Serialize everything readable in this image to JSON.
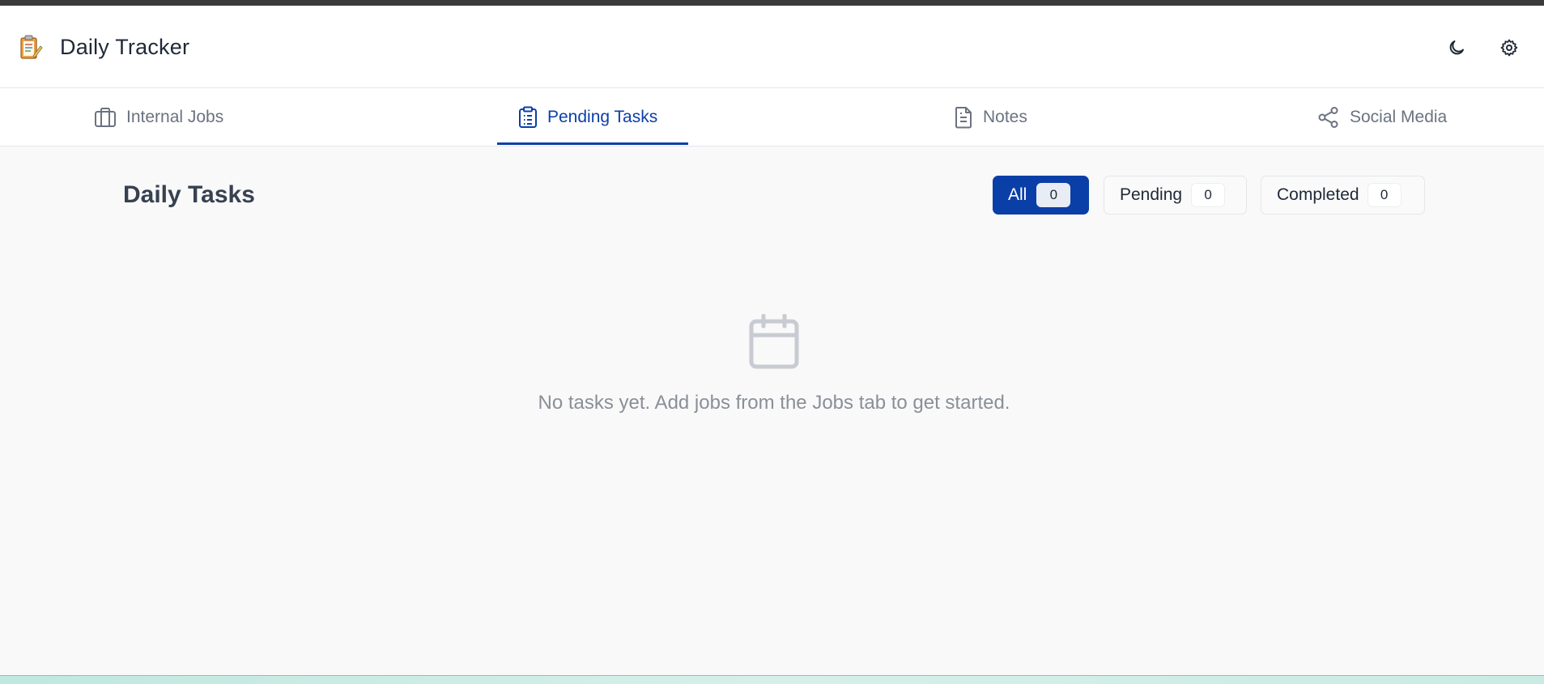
{
  "app": {
    "title": "Daily Tracker",
    "logo_icon": "clipboard-emoji-icon"
  },
  "header_actions": [
    {
      "name": "theme-toggle",
      "icon": "moon-icon"
    },
    {
      "name": "settings",
      "icon": "gear-icon"
    }
  ],
  "tabs": [
    {
      "label": "Internal Jobs",
      "icon": "briefcase-icon",
      "active": false
    },
    {
      "label": "Pending Tasks",
      "icon": "clipboard-list-icon",
      "active": true
    },
    {
      "label": "Notes",
      "icon": "document-icon",
      "active": false
    },
    {
      "label": "Social Media",
      "icon": "share-icon",
      "active": false
    }
  ],
  "main": {
    "title": "Daily Tasks",
    "filters": [
      {
        "label": "All",
        "count": "0",
        "active": true
      },
      {
        "label": "Pending",
        "count": "0",
        "active": false
      },
      {
        "label": "Completed",
        "count": "0",
        "active": false
      }
    ],
    "empty_state": {
      "icon": "calendar-icon",
      "message": "No tasks yet. Add jobs from the Jobs tab to get started."
    }
  },
  "colors": {
    "accent": "#0b3fa8",
    "background": "#f9f9f9",
    "muted_text": "#6b7280"
  }
}
